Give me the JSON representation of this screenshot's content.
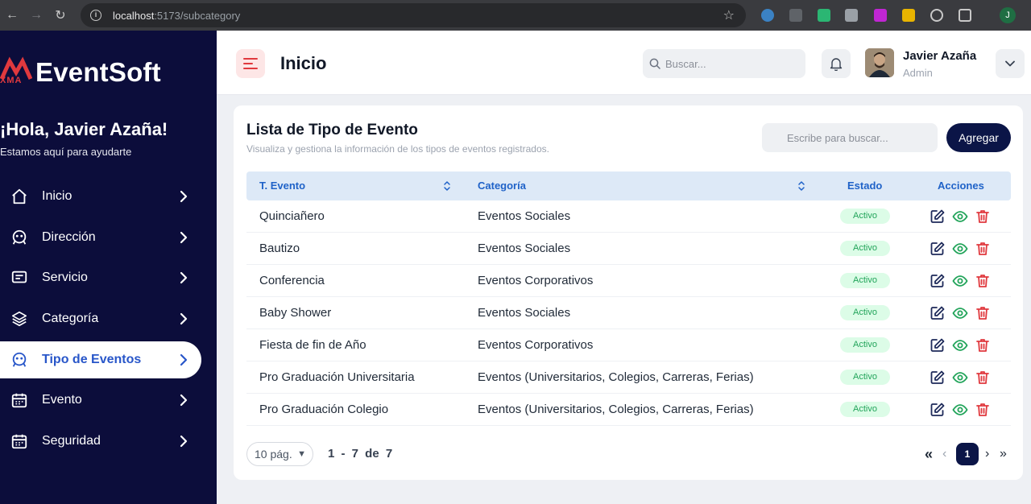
{
  "browser": {
    "url_host": "localhost",
    "url_path": ":5173/subcategory",
    "profile_initial": "J"
  },
  "sidebar": {
    "brand_mark": "XMA",
    "brand_name": "EventSoft",
    "greeting": "¡Hola, Javier Azaña!",
    "greeting_sub": "Estamos aquí para ayudarte",
    "items": [
      {
        "label": "Inicio",
        "icon": "home-icon",
        "active": false
      },
      {
        "label": "Dirección",
        "icon": "address-icon",
        "active": false
      },
      {
        "label": "Servicio",
        "icon": "chat-icon",
        "active": false
      },
      {
        "label": "Categoría",
        "icon": "layers-icon",
        "active": false
      },
      {
        "label": "Tipo de Eventos",
        "icon": "event-type-icon",
        "active": true
      },
      {
        "label": "Evento",
        "icon": "calendar-icon",
        "active": false
      },
      {
        "label": "Seguridad",
        "icon": "security-calendar-icon",
        "active": false
      }
    ]
  },
  "header": {
    "title": "Inicio",
    "search_placeholder": "Buscar...",
    "user_name": "Javier Azaña",
    "user_role": "Admin"
  },
  "card": {
    "title": "Lista de Tipo de Evento",
    "subtitle": "Visualiza y gestiona la información de los tipos de eventos registrados.",
    "search_placeholder": "Escribe para buscar...",
    "add_label": "Agregar"
  },
  "table": {
    "columns": [
      "T. Evento",
      "Categoría",
      "Estado",
      "Acciones"
    ],
    "rows": [
      {
        "tipo": "Quinciañero",
        "categoria": "Eventos Sociales",
        "estado": "Activo"
      },
      {
        "tipo": "Bautizo",
        "categoria": "Eventos Sociales",
        "estado": "Activo"
      },
      {
        "tipo": "Conferencia",
        "categoria": "Eventos Corporativos",
        "estado": "Activo"
      },
      {
        "tipo": "Baby Shower",
        "categoria": "Eventos Sociales",
        "estado": "Activo"
      },
      {
        "tipo": "Fiesta de fin de Año",
        "categoria": "Eventos Corporativos",
        "estado": "Activo"
      },
      {
        "tipo": "Pro Graduación Universitaria",
        "categoria": "Eventos (Universitarios, Colegios, Carreras, Ferias)",
        "estado": "Activo"
      },
      {
        "tipo": "Pro Graduación Colegio",
        "categoria": "Eventos (Universitarios, Colegios, Carreras, Ferias)",
        "estado": "Activo"
      }
    ]
  },
  "pagination": {
    "page_size": "10 pág.",
    "range": "1 - 7 de 7",
    "current_page": "1",
    "first": "«",
    "prev": "‹",
    "next": "›",
    "last": "»"
  },
  "colors": {
    "sidebar_bg": "#0c0d3b",
    "accent_blue": "#1f62c8",
    "primary_dark": "#0b1547",
    "edit": "#1e2a5a",
    "view": "#22a45a",
    "delete": "#e0393e"
  }
}
